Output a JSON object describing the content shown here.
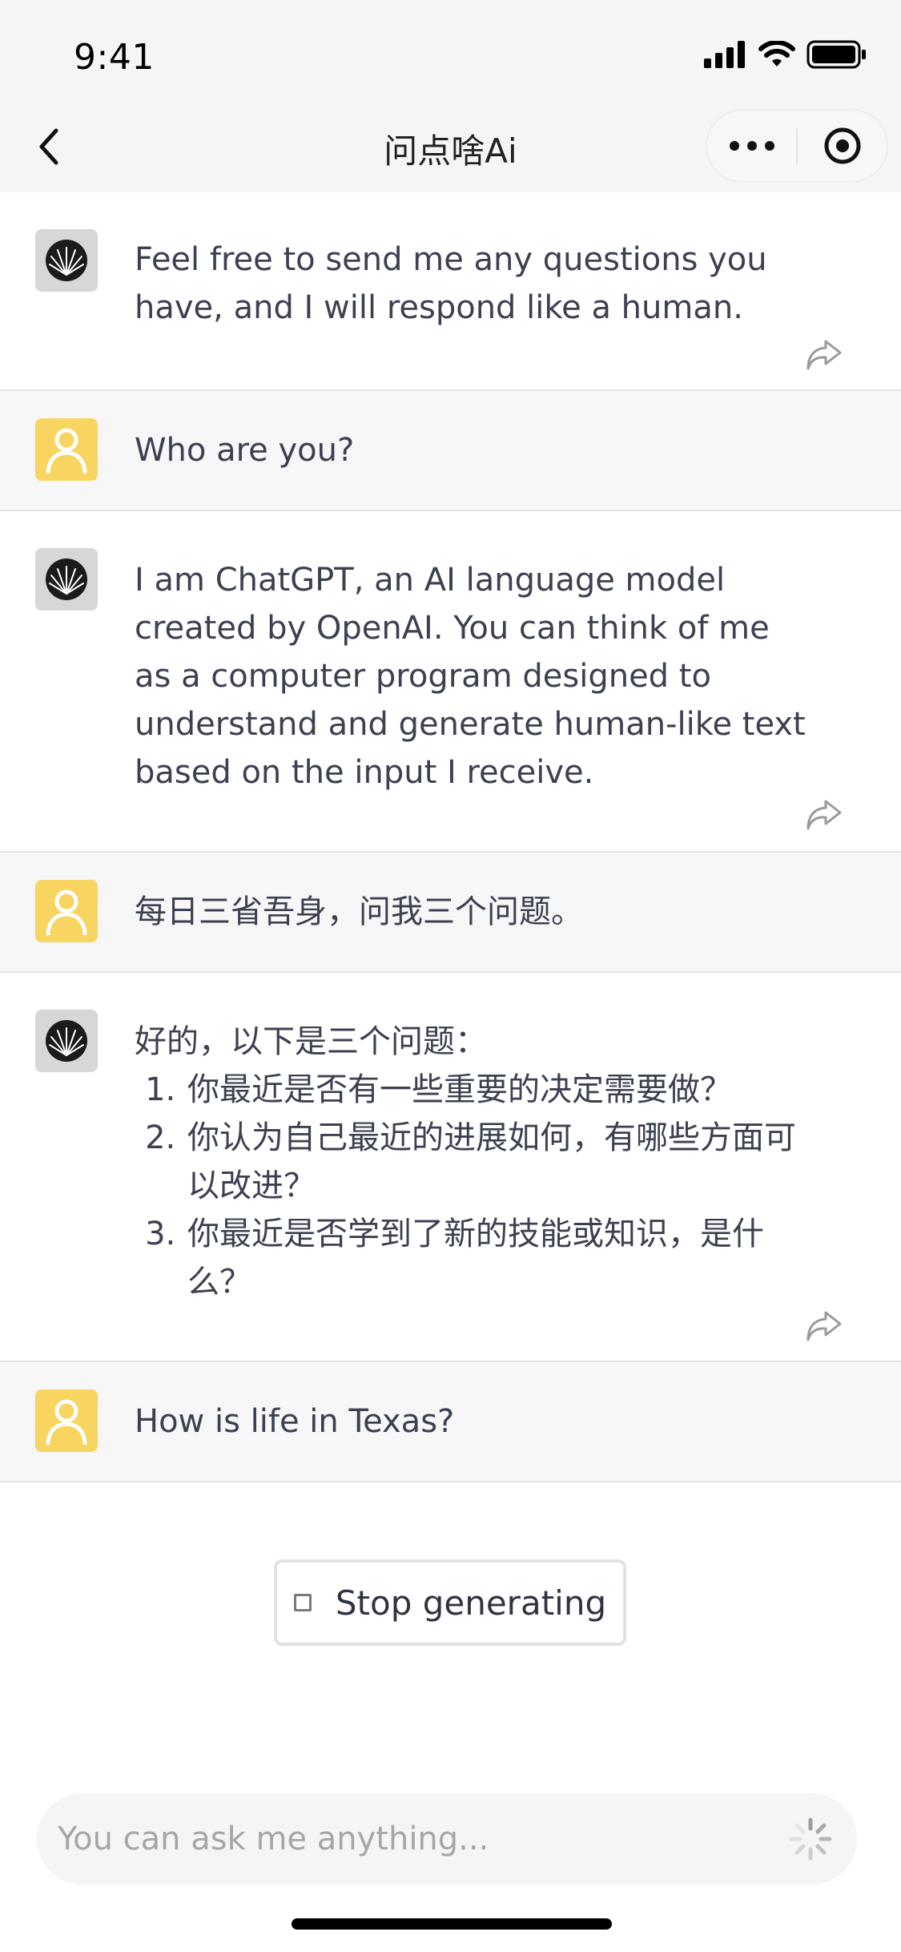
{
  "status_bar": {
    "time": "9:41"
  },
  "nav": {
    "title": "问点啥Ai"
  },
  "messages": [
    {
      "role": "bot",
      "text": "Feel free to send me any questions you have, and I will respond like a human."
    },
    {
      "role": "user",
      "text": "Who are you?"
    },
    {
      "role": "bot",
      "text": "I am ChatGPT, an AI language model created by OpenAI. You can think of me as a computer program designed to understand and generate human-like text based on the input I receive."
    },
    {
      "role": "user",
      "text": "每日三省吾身，问我三个问题。"
    },
    {
      "role": "bot",
      "intro": "好的，以下是三个问题：",
      "items": [
        "你最近是否有一些重要的决定需要做？",
        "你认为自己最近的进展如何，有哪些方面可以改进？",
        "你最近是否学到了新的技能或知识，是什么？"
      ]
    },
    {
      "role": "user",
      "text": "How is life in Texas?"
    }
  ],
  "stop_button": {
    "label": "Stop generating"
  },
  "input": {
    "placeholder": "You can ask me anything...",
    "value": ""
  },
  "colors": {
    "user_avatar": "#f8d461",
    "bot_avatar": "#d7d7d7",
    "user_bg": "#f7f7f8",
    "text": "#3b4150"
  }
}
